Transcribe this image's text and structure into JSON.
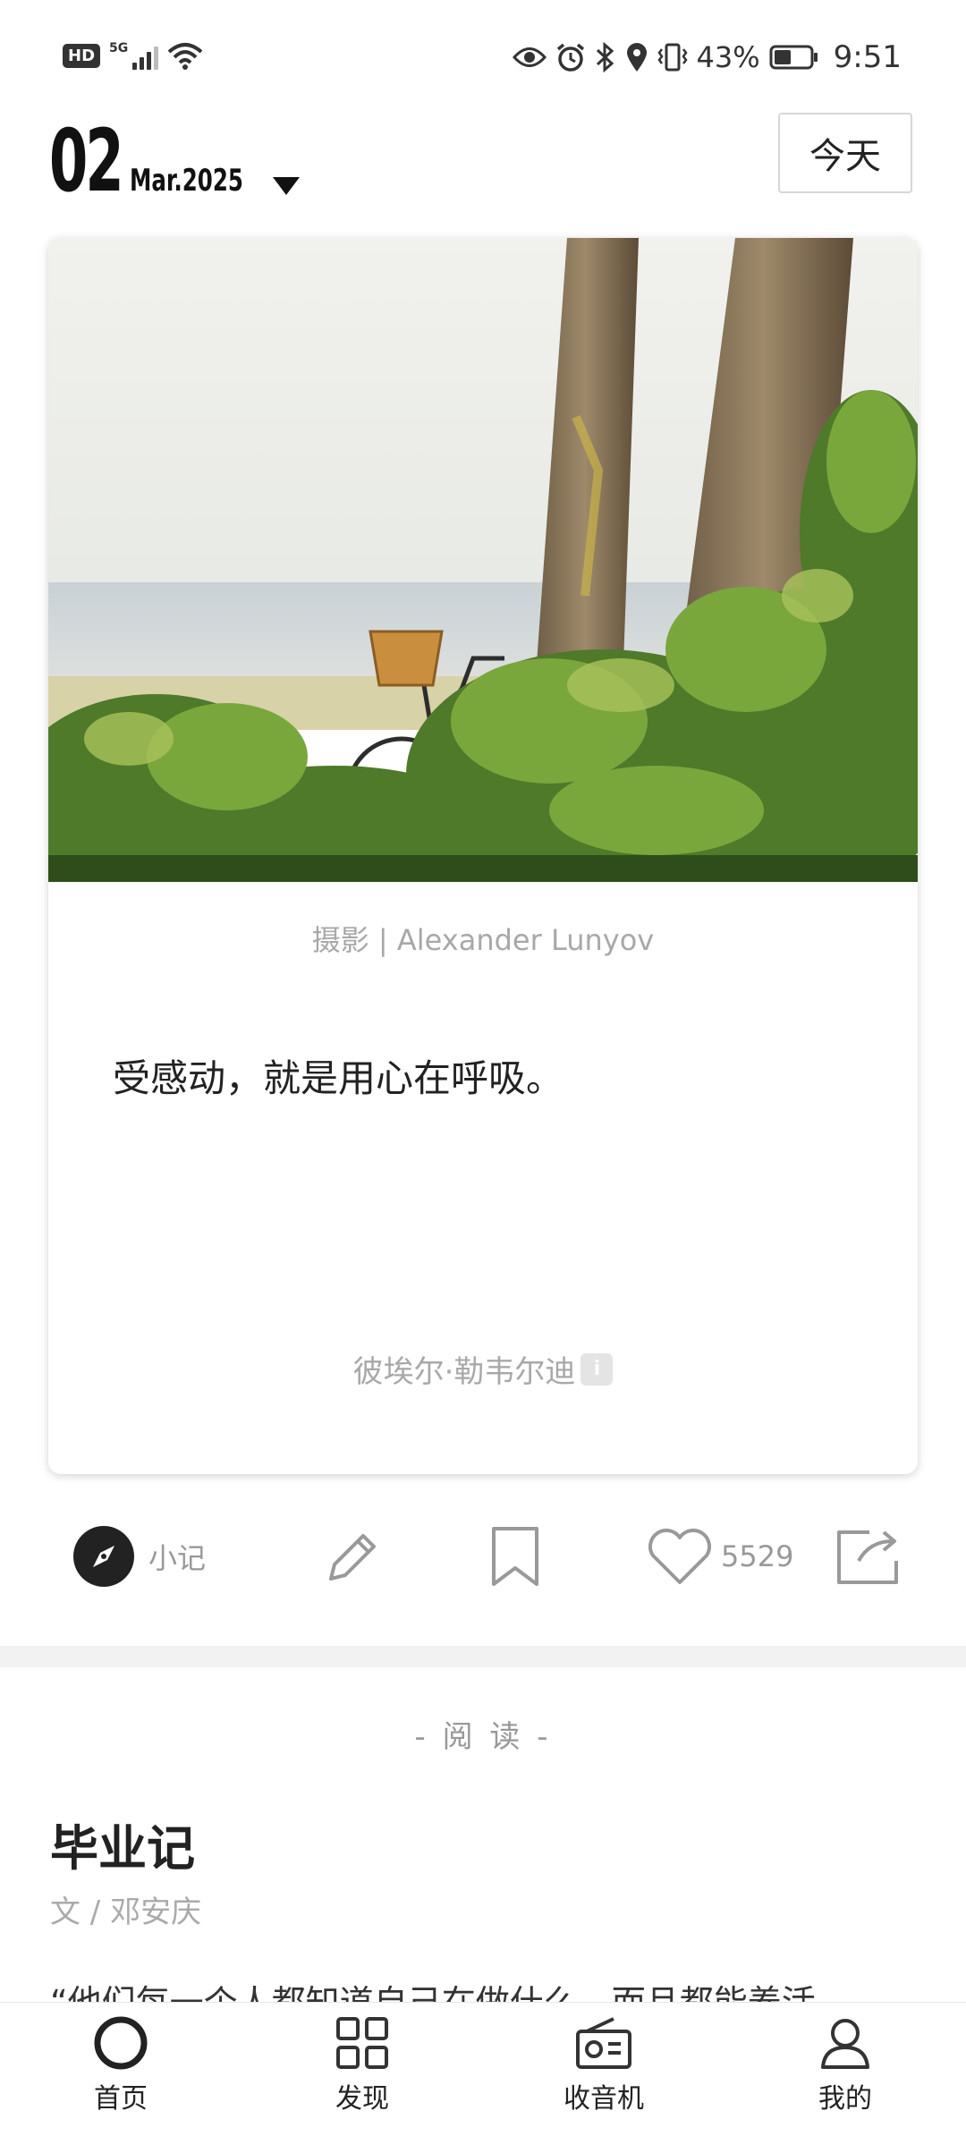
{
  "status_bar": {
    "hd": "HD",
    "network": "5G",
    "battery": "43%",
    "time": "9:51"
  },
  "date": {
    "day": "02",
    "month_year": "Mar.2025",
    "today_button": "今天"
  },
  "card": {
    "photo_credit": "摄影 | Alexander Lunyov",
    "quote": "受感动，就是用心在呼吸。",
    "author": "彼埃尔·勒韦尔迪",
    "info_icon_glyph": "i"
  },
  "actions": {
    "note_label": "小记",
    "like_count": "5529"
  },
  "reading": {
    "section_label": "- 阅 读 -",
    "title": "毕业记",
    "author": "文 / 邓安庆",
    "excerpt": "“他们每一个人都知道自己在做什么，而且都能养活"
  },
  "bottom_nav": {
    "items": [
      {
        "label": "首页",
        "icon": "home-ring-icon"
      },
      {
        "label": "发现",
        "icon": "grid-icon"
      },
      {
        "label": "收音机",
        "icon": "radio-icon"
      },
      {
        "label": "我的",
        "icon": "person-icon"
      }
    ]
  },
  "colors": {
    "muted_text": "#a8a8a8",
    "primary_text": "#222222",
    "divider": "#f2f2f2"
  }
}
